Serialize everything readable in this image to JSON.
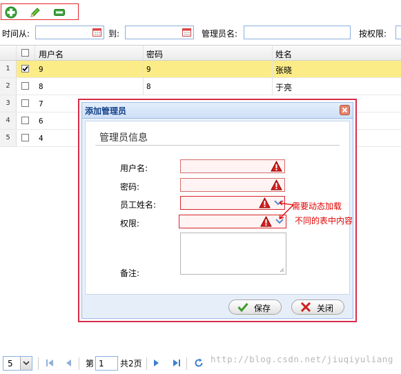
{
  "toolbar": {
    "add": "add-icon",
    "edit": "edit-icon",
    "remove": "remove-icon"
  },
  "filters": {
    "time_from_label": "时间从:",
    "to_label": "到:",
    "admin_name_label": "管理员名:",
    "permission_label": "按权限:"
  },
  "grid": {
    "columns": [
      "用户名",
      "密码",
      "姓名"
    ],
    "rows": [
      {
        "num": "1",
        "checked": true,
        "username": "9",
        "password": "9",
        "name": "张晓"
      },
      {
        "num": "2",
        "checked": false,
        "username": "8",
        "password": "8",
        "name": "于亮"
      },
      {
        "num": "3",
        "checked": false,
        "username": "7",
        "password": "",
        "name": ""
      },
      {
        "num": "4",
        "checked": false,
        "username": "6",
        "password": "",
        "name": ""
      },
      {
        "num": "5",
        "checked": false,
        "username": "4",
        "password": "",
        "name": ""
      }
    ]
  },
  "dialog": {
    "title": "添加管理员",
    "section_title": "管理员信息",
    "labels": {
      "username": "用户名:",
      "password": "密码:",
      "employee_name": "员工姓名:",
      "permission": "权限:",
      "remarks": "备注:"
    },
    "save_label": "保存",
    "close_label": "关闭"
  },
  "annotations": {
    "line1": "需要动态加载",
    "line2": "不同的表中内容"
  },
  "pager": {
    "page_size": "5",
    "page_prefix": "第",
    "page_value": "1",
    "page_total": "共2页"
  },
  "watermark": "http://blog.csdn.net/jiuqiyuliang",
  "colors": {
    "accent_border": "#e5232a",
    "selected_row": "#fbec88",
    "annotation": "#e00000"
  }
}
